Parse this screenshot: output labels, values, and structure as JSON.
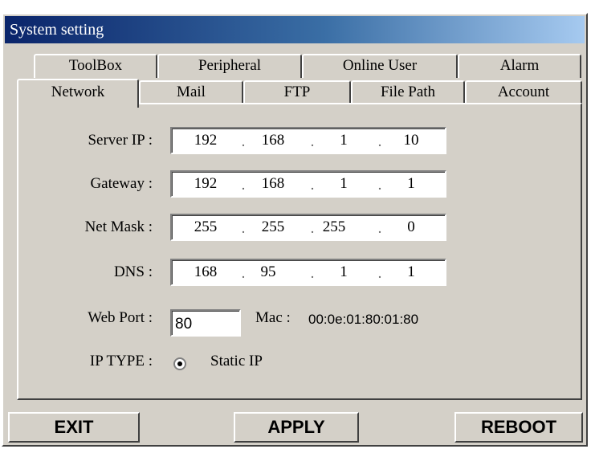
{
  "window": {
    "title": "System setting"
  },
  "tabs": {
    "back_row": [
      "ToolBox",
      "Peripheral",
      "Online User",
      "Alarm"
    ],
    "front_row": [
      "Network",
      "Mail",
      "FTP",
      "File Path",
      "Account"
    ],
    "active": "Network"
  },
  "network": {
    "server_ip": {
      "label": "Server IP :",
      "octets": [
        "192",
        "168",
        "1",
        "10"
      ]
    },
    "gateway": {
      "label": "Gateway :",
      "octets": [
        "192",
        "168",
        "1",
        "1"
      ]
    },
    "net_mask": {
      "label": "Net Mask :",
      "octets": [
        "255",
        "255",
        "255",
        "0"
      ]
    },
    "dns": {
      "label": "DNS :",
      "octets": [
        "168",
        "95",
        "1",
        "1"
      ]
    },
    "ip_separator": ".",
    "web_port": {
      "label": "Web Port :",
      "value": "80"
    },
    "mac": {
      "label": "Mac :",
      "value": "00:0e:01:80:01:80"
    },
    "ip_type": {
      "label": "IP TYPE :",
      "option": "Static IP",
      "selected": true
    }
  },
  "buttons": {
    "exit": "EXIT",
    "apply": "APPLY",
    "reboot": "REBOOT"
  },
  "colors": {
    "face": "#d4d0c8",
    "title_start": "#0a246a",
    "title_end": "#a6caf0"
  }
}
